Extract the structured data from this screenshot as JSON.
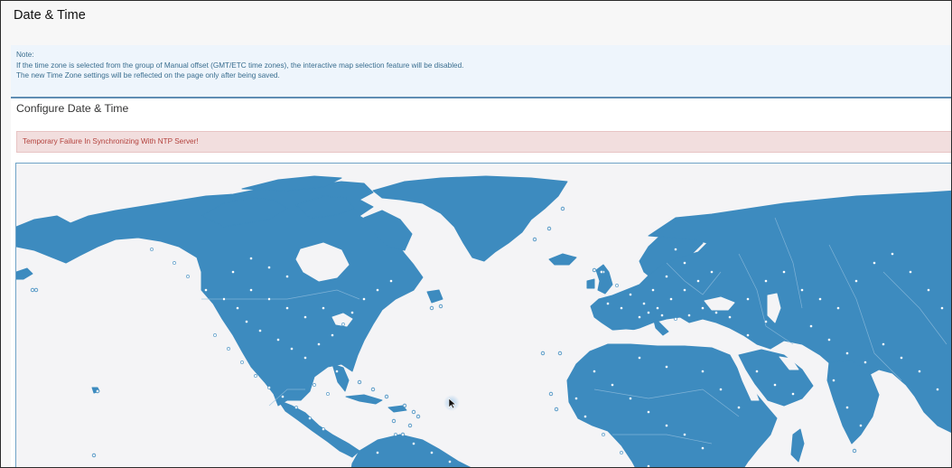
{
  "page": {
    "title": "Date & Time"
  },
  "note": {
    "lines": [
      "Note:",
      "If the time zone is selected from the group of Manual offset (GMT/ETC time zones), the interactive map selection feature will be disabled.",
      "The new Time Zone settings will be reflected on the page only after being saved."
    ]
  },
  "config": {
    "title": "Configure Date & Time",
    "alert": "Temporary Failure In Synchronizing With NTP Server!"
  },
  "map": {
    "land_color": "#3d8bbf",
    "ocean_color": "#f4f4f6",
    "marker_color": "#ffffff",
    "selection": "none"
  },
  "icons": {
    "cursor": "arrow-cursor-icon"
  }
}
